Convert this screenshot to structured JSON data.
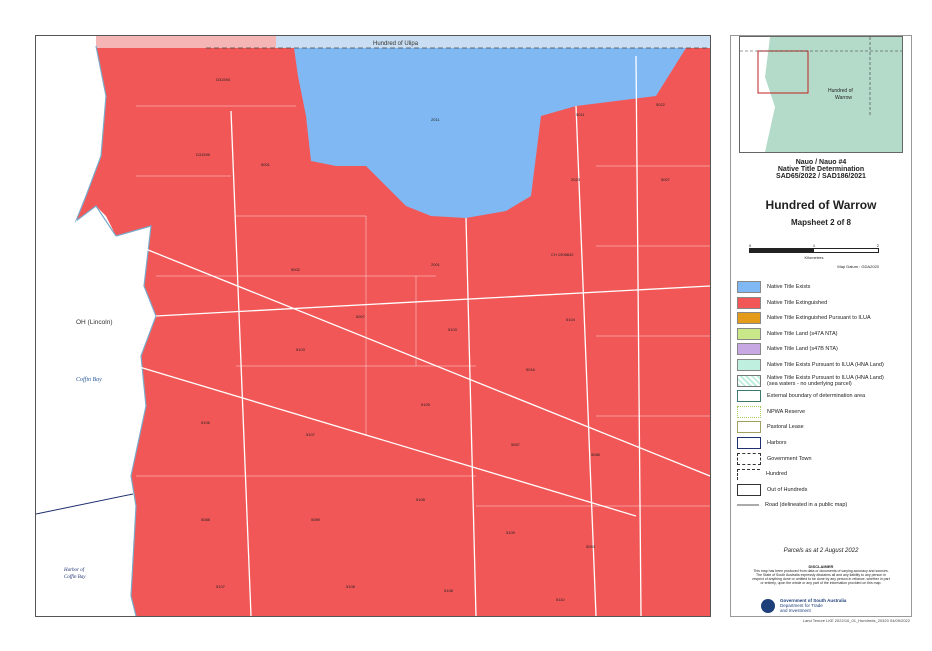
{
  "map": {
    "top_label": "Hundred of Ulipa",
    "place_labels": {
      "oh_lincoln": "OH (Lincoln)",
      "coffin_bay": "Coffin Bay",
      "harbor": "Harbor of\nCoffin Bay"
    },
    "colors": {
      "extinguished": "#f25757",
      "exists": "#7fb8f2",
      "coast_land": "#ffffff",
      "sea": "#e8f4fb",
      "road": "#ffffff"
    }
  },
  "panel": {
    "inset_label": "Hundred of\nWarrow",
    "claim_line1": "Nauo / Nauo #4",
    "claim_line2": "Native Title Determination",
    "claim_line3": "SAD65/2022 / SAD186/2021",
    "title": "Hundred of Warrow",
    "subtitle": "Mapsheet 2 of 8",
    "scale_0": "0",
    "scale_1": "1",
    "scale_2": "2",
    "scale_unit": "Kilometres",
    "datum": "Map Datum : GDA2020"
  },
  "legend": [
    {
      "label": "Native Title Exists",
      "color": "#7fb8f2",
      "style": "fill"
    },
    {
      "label": "Native Title Extinguished",
      "color": "#f25757",
      "style": "fill"
    },
    {
      "label": "Native Title Extinguished Pursuant to ILUA",
      "color": "#e59b1a",
      "style": "fill"
    },
    {
      "label": "Native Title Land (s47A NTA)",
      "color": "#c9e889",
      "style": "fill"
    },
    {
      "label": "Native Title Land (s47B NTA)",
      "color": "#c8a8e2",
      "style": "fill"
    },
    {
      "label": "Native Title Exists Pursuant to ILUA (HNA Land)",
      "color": "#bff0df",
      "style": "fill"
    },
    {
      "label": "Native Title Exists Pursuant to ILUA (HNA Land)\n(sea waters - no underlying parcel)",
      "color": "#bff0df",
      "style": "hatch"
    },
    {
      "label": "External boundary of determination area",
      "color": "#3a7a6a",
      "style": "outline"
    },
    {
      "label": "NPWA Reserve",
      "color": "#a8c860",
      "style": "dotted"
    },
    {
      "label": "Pastoral Lease",
      "color": "#a0a060",
      "style": "outline"
    },
    {
      "label": "Harbors",
      "color": "#1d2f6f",
      "style": "outline"
    },
    {
      "label": "Government Town",
      "color": "#333333",
      "style": "dashed"
    },
    {
      "label": "Hundred",
      "color": "#333333",
      "style": "corner"
    },
    {
      "label": "Out of Hundreds",
      "color": "#333333",
      "style": "outline"
    },
    {
      "label": "Road (delineated in a public map)",
      "color": "#aaaaaa",
      "style": "road"
    }
  ],
  "footer": {
    "parcels_date": "Parcels as at 2 August 2022",
    "disclaimer_title": "DISCLAIMER",
    "disclaimer_text": "This map has been produced from data or documents of varying accuracy and sources. The State of South Australia expressly disclaims all and any liability to any person in respect of anything done or omitted to be done by any person in reliance, whether in part or entirely, upon the whole or any part of the information provided on this map.",
    "gov_line1": "Government of South Australia",
    "gov_line2": "Department for Trade",
    "gov_line3": "and Investment",
    "ref": "Land Tenure LKE 2022/10_01_Hundreds_20320 04/09/2022"
  }
}
